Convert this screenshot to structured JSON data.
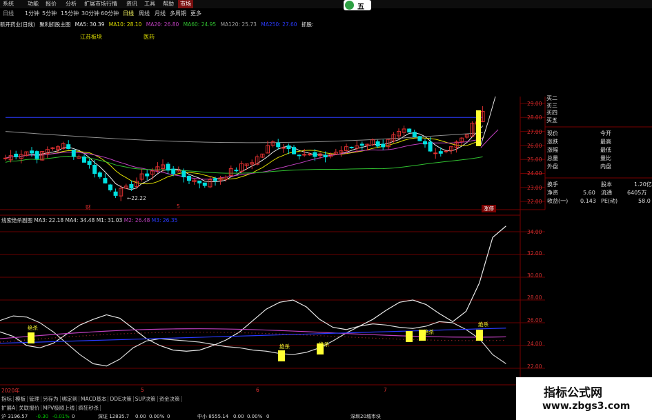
{
  "menu": {
    "items": [
      "系统",
      "功能",
      "报价",
      "分析",
      "扩展市场行情",
      "资讯",
      "工具",
      "帮助"
    ],
    "active": "市场",
    "logo_text": "五"
  },
  "periods": {
    "items": [
      "日线",
      "1分钟",
      "5分钟",
      "15分钟",
      "30分钟",
      "60分钟",
      "日线",
      "周线",
      "月线",
      "多周期",
      "更多"
    ],
    "selected_index": 6
  },
  "ma_line": {
    "stock_title": "新开药业(日线)",
    "indicator": "聚利抓股主图",
    "ma5": "MA5: 30.39",
    "ma10": "MA10: 28.10",
    "ma20": "MA20: 26.80",
    "ma60": "MA60: 24.95",
    "ma120": "MA120: 25.73",
    "ma250": "MA250: 27.60",
    "tail": "抓股:"
  },
  "boards": [
    "江苏板块",
    "医药"
  ],
  "price_axis": [
    "29.00",
    "28.00",
    "27.00",
    "26.00",
    "25.00",
    "24.00",
    "23.00",
    "22.00"
  ],
  "low_marker": "22.22",
  "upper_markers": [
    "财",
    "5"
  ],
  "limit_up_label": "涨停",
  "sub_title": {
    "name": "线索绝杀副图",
    "ma3": "MA3: 22.18",
    "ma4": "MA4: 34.48",
    "m1": "M1: 31.03",
    "m2": "M2: 26.48",
    "m3": "M3: 26.35"
  },
  "sub_axis": [
    "34.00",
    "32.00",
    "30.00",
    "28.00",
    "26.00",
    "24.00",
    "22.00"
  ],
  "signal_label": "绝杀",
  "date_labels": [
    "2020年",
    "5",
    "6",
    "7"
  ],
  "quote": {
    "buy_rows": [
      "买二",
      "买三",
      "买四",
      "买五"
    ],
    "rows": [
      {
        "l": "现价",
        "r": "今开"
      },
      {
        "l": "涨跌",
        "r": "最高"
      },
      {
        "l": "涨幅",
        "r": "最低"
      },
      {
        "l": "总量",
        "r": "量比"
      },
      {
        "l": "外盘",
        "r": "内盘"
      }
    ],
    "stats": [
      {
        "l": "换手",
        "v": "",
        "r": "股本",
        "rv": "1.20亿"
      },
      {
        "l": "净资",
        "v": "5.60",
        "r": "流通",
        "rv": "6405万"
      },
      {
        "l": "收益(一)",
        "v": "0.143",
        "r": "PE(动)",
        "rv": "58.0"
      }
    ]
  },
  "bottom_tabs": [
    "指标",
    "模板",
    "管理",
    "另存为",
    "绑定到",
    "MACD基本",
    "DDE决策",
    "SUP决策",
    "资金决策"
  ],
  "bottom_tabs2": [
    "扩展A",
    "关联报价",
    "MPV极顺上线",
    "疯狂秒杀"
  ],
  "status_bar": [
    "沪 3196.57",
    "-0.30",
    "-0.01%",
    "0",
    "深证 12835.7",
    "0.00",
    "0.00%",
    "0",
    "中小 8555.14",
    "0.00",
    "0.00%",
    "0",
    "深圳20城市块"
  ],
  "watermark": {
    "title": "指标公式网",
    "url": "www.zbgs3.com"
  },
  "colors": {
    "up": "#e03030",
    "down": "#00e0e0",
    "yellow": "#ffff33",
    "ma_white": "#e8e8e8",
    "ma_yellow": "#e0e000",
    "ma_purple": "#c040c0",
    "ma_green": "#30c030",
    "ma_blue": "#2a3aff",
    "grid": "#6a0000"
  }
}
